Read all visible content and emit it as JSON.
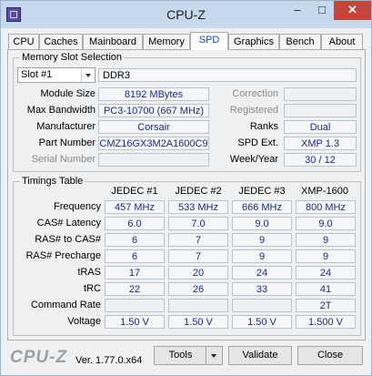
{
  "window": {
    "title": "CPU-Z"
  },
  "tabs": [
    "CPU",
    "Caches",
    "Mainboard",
    "Memory",
    "SPD",
    "Graphics",
    "Bench",
    "About"
  ],
  "slot_group": {
    "legend": "Memory Slot Selection",
    "slot": "Slot #1",
    "type": "DDR3",
    "module_size_label": "Module Size",
    "module_size": "8192 MBytes",
    "max_bw_label": "Max Bandwidth",
    "max_bw": "PC3-10700 (667 MHz)",
    "manufacturer_label": "Manufacturer",
    "manufacturer": "Corsair",
    "part_label": "Part Number",
    "part": "CMZ16GX3M2A1600C9",
    "serial_label": "Serial Number",
    "serial": "",
    "correction_label": "Correction",
    "correction": "",
    "registered_label": "Registered",
    "registered": "",
    "ranks_label": "Ranks",
    "ranks": "Dual",
    "spd_ext_label": "SPD Ext.",
    "spd_ext": "XMP 1.3",
    "week_year_label": "Week/Year",
    "week_year": "30 / 12"
  },
  "timings": {
    "legend": "Timings Table",
    "columns": [
      "JEDEC #1",
      "JEDEC #2",
      "JEDEC #3",
      "XMP-1600"
    ],
    "rows": [
      {
        "label": "Frequency",
        "values": [
          "457 MHz",
          "533 MHz",
          "666 MHz",
          "800 MHz"
        ]
      },
      {
        "label": "CAS# Latency",
        "values": [
          "6.0",
          "7.0",
          "9.0",
          "9.0"
        ]
      },
      {
        "label": "RAS# to CAS#",
        "values": [
          "6",
          "7",
          "9",
          "9"
        ]
      },
      {
        "label": "RAS# Precharge",
        "values": [
          "6",
          "7",
          "9",
          "9"
        ]
      },
      {
        "label": "tRAS",
        "values": [
          "17",
          "20",
          "24",
          "24"
        ]
      },
      {
        "label": "tRC",
        "values": [
          "22",
          "26",
          "33",
          "41"
        ]
      },
      {
        "label": "Command Rate",
        "values": [
          "",
          "",
          "",
          "2T"
        ]
      },
      {
        "label": "Voltage",
        "values": [
          "1.50 V",
          "1.50 V",
          "1.50 V",
          "1.500 V"
        ]
      }
    ]
  },
  "footer": {
    "logo": "CPU-Z",
    "version": "Ver. 1.77.0.x64",
    "tools": "Tools",
    "validate": "Validate",
    "close": "Close"
  }
}
